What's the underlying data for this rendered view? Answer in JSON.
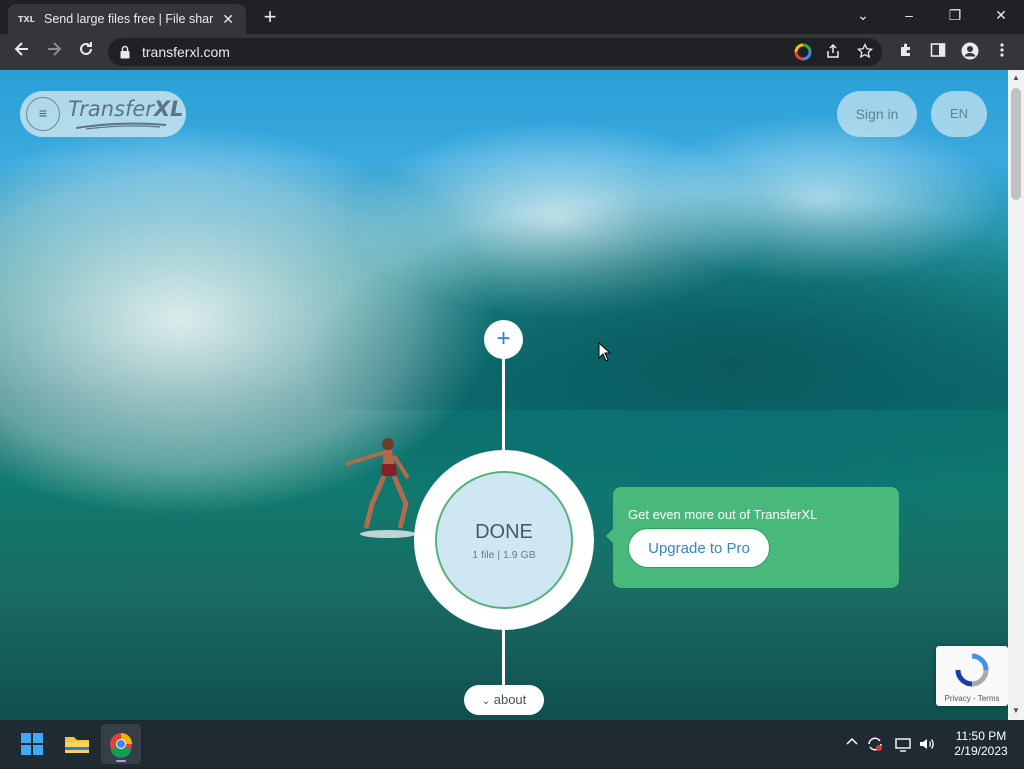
{
  "browser": {
    "tab_title": "Send large files free | File sharing",
    "tab_favicon": "TXL",
    "url": "transferxl.com",
    "new_tab_symbol": "+",
    "tab_close_symbol": "✕",
    "window_controls": {
      "minimize": "–",
      "restore": "❐",
      "close": "✕",
      "tab_search": "⌄"
    }
  },
  "page": {
    "logo": {
      "part1": "Transfer",
      "part2": "XL"
    },
    "menu_symbol": "≡",
    "signin_label": "Sign in",
    "language_label": "EN",
    "add_symbol": "+",
    "status": {
      "label": "DONE",
      "detail": "1 file | 1.9 GB"
    },
    "promo": {
      "text": "Get even more out of TransferXL",
      "button_label": "Upgrade to Pro"
    },
    "about_label": "about",
    "recaptcha_links": "Privacy - Terms"
  },
  "taskbar": {
    "time": "11:50 PM",
    "date": "2/19/2023"
  },
  "colors": {
    "promo_green": "#48b97a",
    "link_blue": "#3288c2",
    "done_fill": "#cfe6f3"
  }
}
